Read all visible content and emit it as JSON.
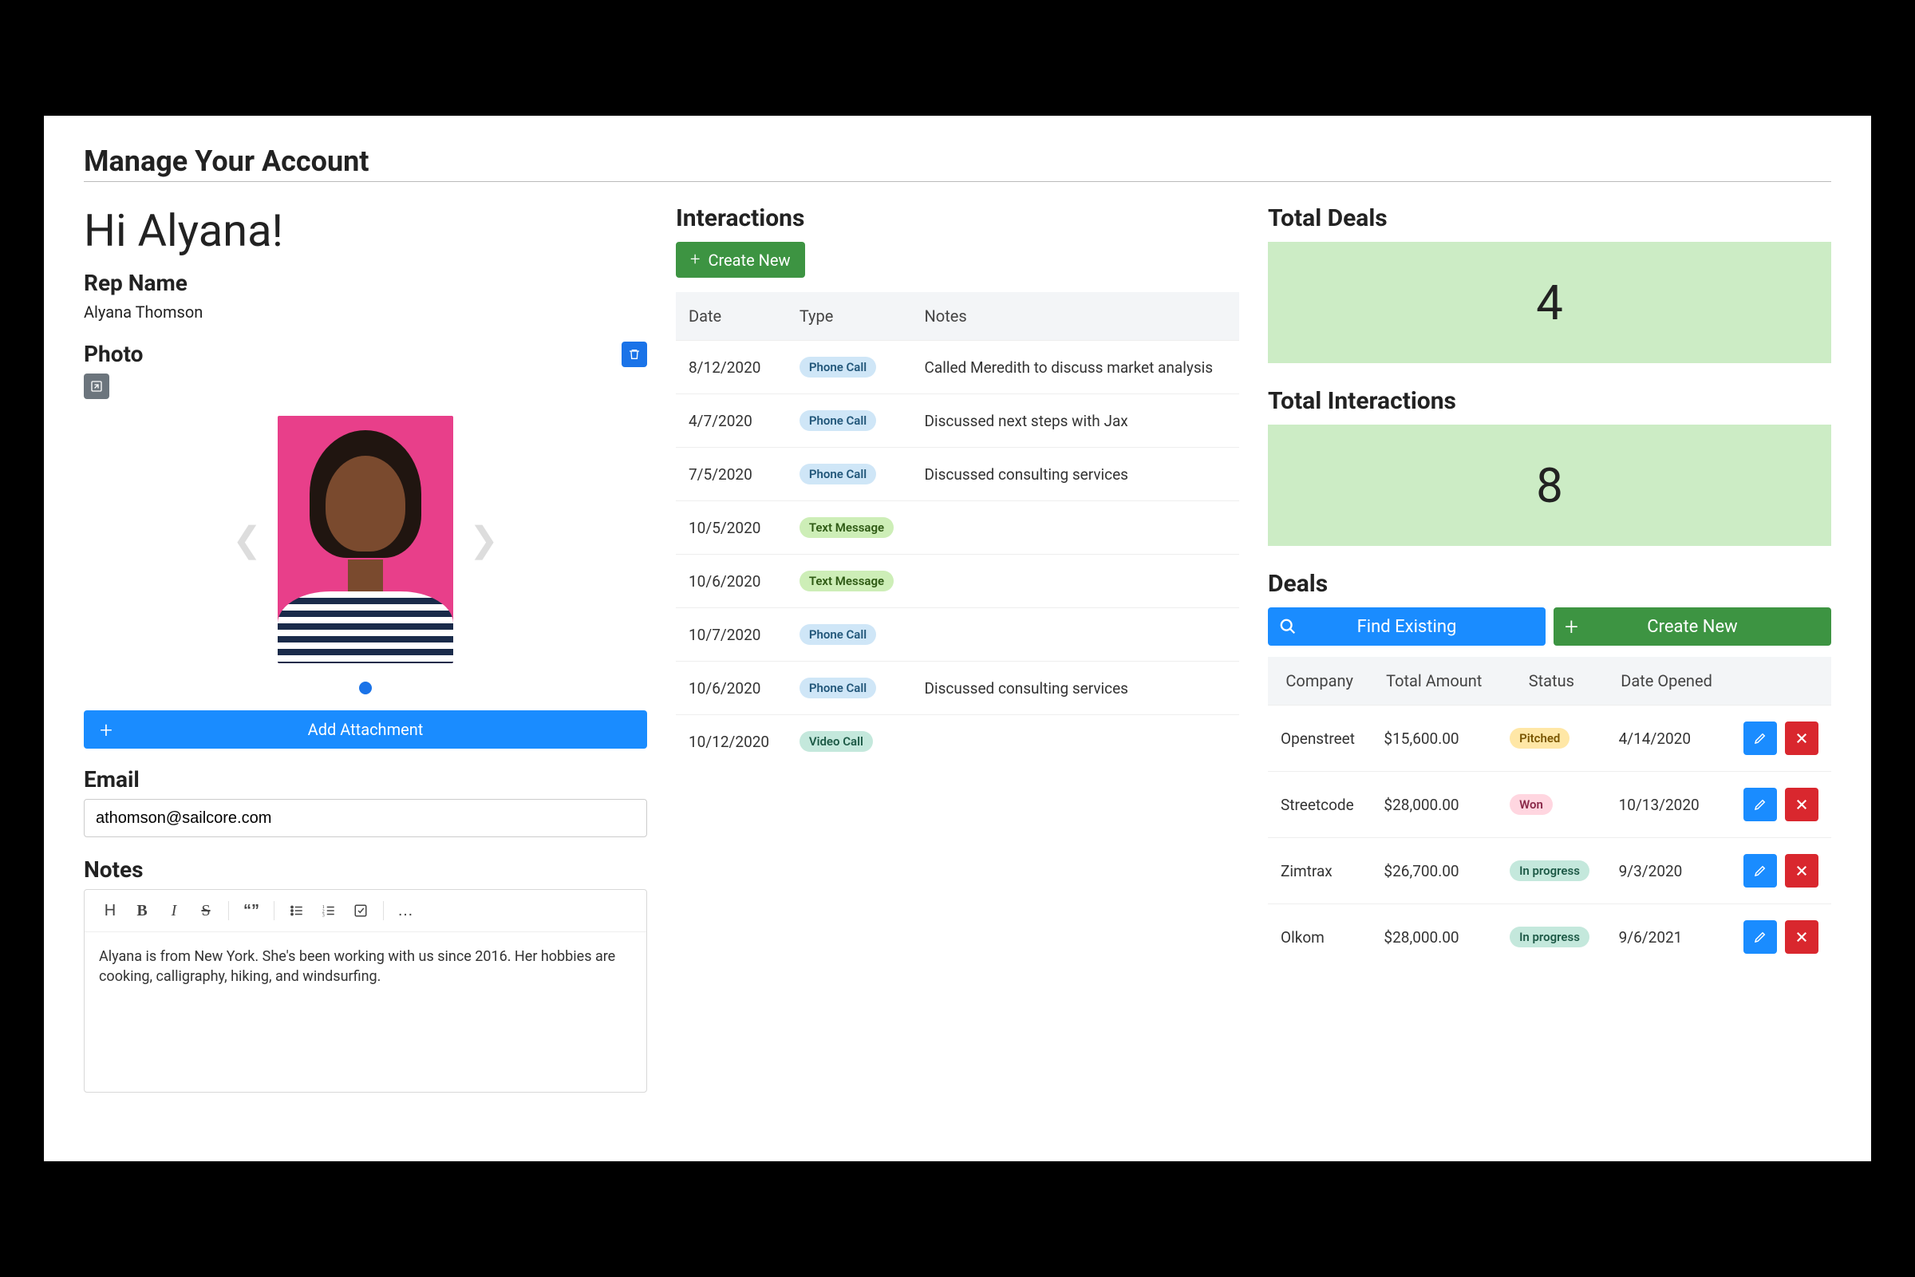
{
  "pageTitle": "Manage Your Account",
  "greeting": "Hi Alyana!",
  "labels": {
    "repName": "Rep Name",
    "photo": "Photo",
    "addAttachment": "Add Attachment",
    "email": "Email",
    "notes": "Notes",
    "interactions": "Interactions",
    "createNew": "Create New",
    "totalDeals": "Total Deals",
    "totalInteractions": "Total Interactions",
    "deals": "Deals",
    "findExisting": "Find Existing"
  },
  "rep": {
    "name": "Alyana Thomson",
    "email": "athomson@sailcore.com",
    "notesText": "Alyana is from New York. She's been working with us since 2016. Her hobbies are cooking, calligraphy, hiking, and windsurfing."
  },
  "interactionsTable": {
    "headers": {
      "date": "Date",
      "type": "Type",
      "notes": "Notes"
    },
    "rows": [
      {
        "date": "8/12/2020",
        "type": "Phone Call",
        "typeClass": "pill-phone",
        "notes": "Called Meredith to discuss market analysis"
      },
      {
        "date": "4/7/2020",
        "type": "Phone Call",
        "typeClass": "pill-phone",
        "notes": "Discussed next steps with Jax"
      },
      {
        "date": "7/5/2020",
        "type": "Phone Call",
        "typeClass": "pill-phone",
        "notes": "Discussed consulting services"
      },
      {
        "date": "10/5/2020",
        "type": "Text Message",
        "typeClass": "pill-text",
        "notes": ""
      },
      {
        "date": "10/6/2020",
        "type": "Text Message",
        "typeClass": "pill-text",
        "notes": ""
      },
      {
        "date": "10/7/2020",
        "type": "Phone Call",
        "typeClass": "pill-phone",
        "notes": ""
      },
      {
        "date": "10/6/2020",
        "type": "Phone Call",
        "typeClass": "pill-phone",
        "notes": "Discussed consulting services"
      },
      {
        "date": "10/12/2020",
        "type": "Video Call",
        "typeClass": "pill-video",
        "notes": ""
      }
    ]
  },
  "stats": {
    "totalDeals": "4",
    "totalInteractions": "8"
  },
  "dealsTable": {
    "headers": {
      "company": "Company",
      "amount": "Total Amount",
      "status": "Status",
      "opened": "Date Opened"
    },
    "rows": [
      {
        "company": "Openstreet",
        "amount": "$15,600.00",
        "status": "Pitched",
        "statusClass": "pill-pitched",
        "opened": "4/14/2020"
      },
      {
        "company": "Streetcode",
        "amount": "$28,000.00",
        "status": "Won",
        "statusClass": "pill-won",
        "opened": "10/13/2020"
      },
      {
        "company": "Zimtrax",
        "amount": "$26,700.00",
        "status": "In progress",
        "statusClass": "pill-inprog",
        "opened": "9/3/2020"
      },
      {
        "company": "Olkom",
        "amount": "$28,000.00",
        "status": "In progress",
        "statusClass": "pill-inprog",
        "opened": "9/6/2021"
      }
    ]
  }
}
